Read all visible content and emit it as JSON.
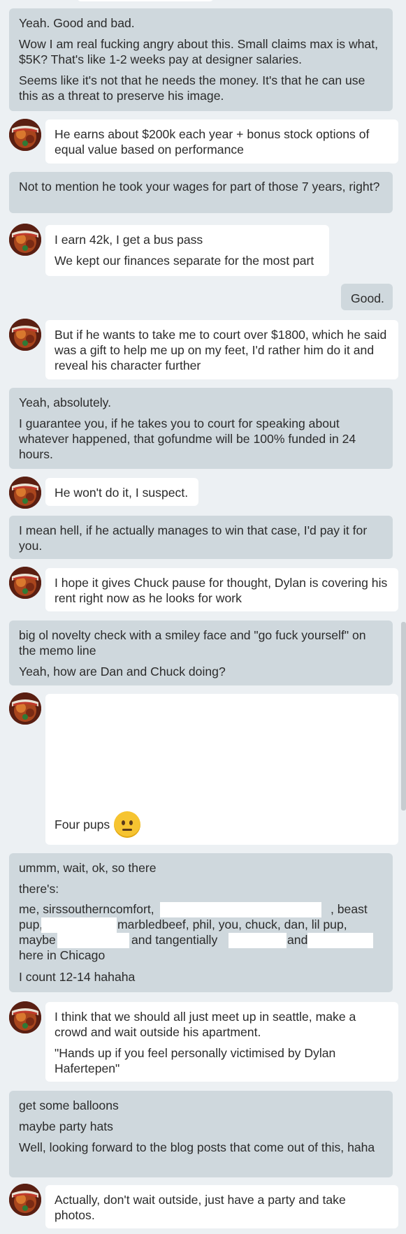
{
  "messages": [
    {
      "dir": "out",
      "lines": [
        "Yeah. Good and bad.",
        "Wow I am real fucking angry about this. Small claims max is what, $5K? That's like 1-2 weeks pay at designer salaries.",
        "Seems like it's not that he needs the money. It's that he can use this as a threat to preserve his image."
      ]
    },
    {
      "dir": "in",
      "lines": [
        "He earns about $200k each year + bonus stock options of equal value based on performance"
      ]
    },
    {
      "dir": "out",
      "lines": [
        "Not to mention he took your wages for part of those 7 years, right?"
      ]
    },
    {
      "dir": "in",
      "lines": [
        "I earn 42k, I get a bus pass",
        "We kept our finances separate for the most part"
      ]
    },
    {
      "dir": "out",
      "lines": [
        "Good."
      ]
    },
    {
      "dir": "in",
      "lines": [
        "But if he wants to take me to court over $1800, which he said was a gift to help me up on my feet, I'd rather him do it and reveal his character further"
      ]
    },
    {
      "dir": "out",
      "lines": [
        "Yeah, absolutely.",
        "I guarantee you, if he takes you to court for speaking about whatever happened, that gofundme will be 100% funded in 24 hours."
      ]
    },
    {
      "dir": "in",
      "lines": [
        "He won't do it, I suspect."
      ]
    },
    {
      "dir": "out",
      "lines": [
        "I mean hell, if he actually manages to win that case, I'd pay it for you."
      ]
    },
    {
      "dir": "in",
      "lines": [
        "I hope it gives Chuck pause for thought, Dylan is covering his rent right now as he looks for work"
      ]
    },
    {
      "dir": "out",
      "lines": [
        "big ol novelty check with a smiley face and \"go fuck yourself\" on the memo line",
        "Yeah, how are Dan and Chuck doing?"
      ]
    },
    {
      "dir": "in",
      "lines": [
        "Four pups"
      ],
      "emoji": "neutral-face"
    },
    {
      "dir": "out",
      "lines": [
        "ummm, wait, ok, so there",
        "there's:"
      ]
    },
    {
      "dir": "out",
      "lines": [
        "me, sirssoutherncomfort,",
        ", beast",
        "pup,",
        "marbledbeef, phil, you, chuck, dan, lil pup,",
        "maybe",
        "and tangentially",
        "and",
        "here in Chicago",
        "I count 12-14 hahaha"
      ]
    },
    {
      "dir": "in",
      "lines": [
        "I think that we should all just meet up in seattle, make a crowd and wait outside his apartment.",
        "\"Hands up if you feel personally victimised by Dylan Hafertepen\""
      ]
    },
    {
      "dir": "out",
      "lines": [
        "get some balloons",
        "maybe party hats",
        "Well, looking forward to the blog posts that come out of this, haha"
      ]
    },
    {
      "dir": "in",
      "lines": [
        "Actually, don't wait outside, just have a party and take photos."
      ]
    }
  ],
  "avatar_icon": "avatar-icon",
  "colors": {
    "background": "#ecf0f3",
    "outgoing_bubble": "#cfd8dd",
    "incoming_bubble": "#ffffff",
    "text": "#2b2b2b"
  }
}
